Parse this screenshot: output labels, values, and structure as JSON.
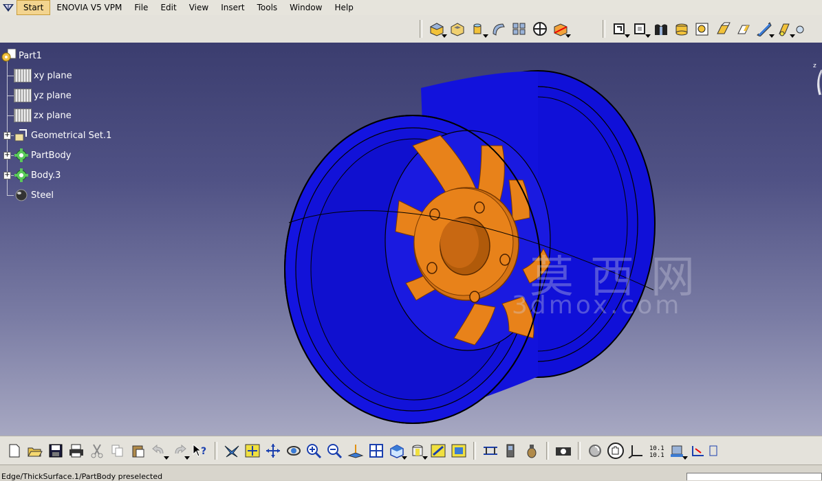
{
  "menu": {
    "items": [
      {
        "label": "Start",
        "active": true,
        "underline": 0
      },
      {
        "label": "ENOVIA V5 VPM",
        "active": false,
        "underline": -1
      },
      {
        "label": "File",
        "active": false,
        "underline": 0
      },
      {
        "label": "Edit",
        "active": false,
        "underline": 0
      },
      {
        "label": "View",
        "active": false,
        "underline": 0
      },
      {
        "label": "Insert",
        "active": false,
        "underline": 0
      },
      {
        "label": "Tools",
        "active": false,
        "underline": 0
      },
      {
        "label": "Window",
        "active": false,
        "underline": 0
      },
      {
        "label": "Help",
        "active": false,
        "underline": 0
      }
    ]
  },
  "tree": {
    "root": "Part1",
    "nodes": [
      {
        "label": "xy plane",
        "icon": "plane-icon"
      },
      {
        "label": "yz plane",
        "icon": "plane-icon"
      },
      {
        "label": "zx plane",
        "icon": "plane-icon"
      },
      {
        "label": "Geometrical Set.1",
        "icon": "geometrical-set-icon",
        "expandable": true
      },
      {
        "label": "PartBody",
        "icon": "gear-icon",
        "expandable": true
      },
      {
        "label": "Body.3",
        "icon": "gear-icon",
        "expandable": true
      },
      {
        "label": "Steel",
        "icon": "material-sphere-icon"
      }
    ]
  },
  "viewport": {
    "model": "wheel-rim",
    "rim_color": "#1a1ae6",
    "hub_color": "#e8821a"
  },
  "watermark": {
    "cn": "莫西网",
    "url": "3dmox.com"
  },
  "toolbar_top": [
    "pad-icon",
    "pocket-icon",
    "shaft-icon",
    "edge-fillet-icon",
    "pattern-icon",
    "compass-icon",
    "cube-icon",
    "plane-icon",
    "box-icon",
    "wheel-icon",
    "cylinder-icon",
    "hole-icon",
    "translate-icon",
    "rotate-icon",
    "measure-icon",
    "sketch-icon",
    "more-icon"
  ],
  "toolbar_bottom": [
    "new-icon",
    "open-icon",
    "save-icon",
    "print-icon",
    "cut-icon",
    "copy-icon",
    "paste-icon",
    "undo-icon",
    "redo-icon",
    "help-icon",
    "fly-mode-icon",
    "fit-all-icon",
    "pan-icon",
    "rotate-view-icon",
    "zoom-in-icon",
    "zoom-out-icon",
    "normal-view-icon",
    "multi-view-icon",
    "iso-view-icon",
    "shading-icon",
    "hide-show-icon",
    "swap-visible-icon",
    "measure-between-icon",
    "measure-item-icon",
    "apply-material-icon",
    "capture-icon",
    "update-icon",
    "manipulate-icon",
    "axis-icon",
    "coordinates-icon",
    "datum-icon",
    "more-tools-icon"
  ],
  "status": {
    "text": "Edge/ThickSurface.1/PartBody preselected",
    "input_value": ""
  }
}
